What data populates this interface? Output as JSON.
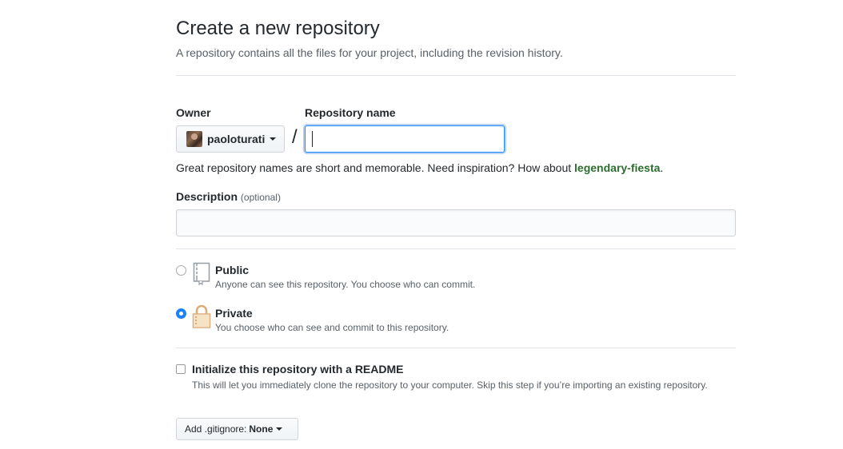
{
  "header": {
    "title": "Create a new repository",
    "subtitle": "A repository contains all the files for your project, including the revision history."
  },
  "owner": {
    "label": "Owner",
    "value": "paoloturati"
  },
  "separator": "/",
  "repo_name": {
    "label": "Repository name",
    "value": "",
    "placeholder": ""
  },
  "hint": {
    "text": "Great repository names are short and memorable. Need inspiration? How about ",
    "suggestion": "legendary-fiesta",
    "end": "."
  },
  "description": {
    "label": "Description",
    "optional": "(optional)",
    "value": "",
    "placeholder": ""
  },
  "visibility": {
    "selected": "private",
    "options": [
      {
        "id": "public",
        "title": "Public",
        "desc": "Anyone can see this repository. You choose who can commit.",
        "icon": "repo-book-icon"
      },
      {
        "id": "private",
        "title": "Private",
        "desc": "You choose who can see and commit to this repository.",
        "icon": "lock-icon"
      }
    ]
  },
  "readme": {
    "label": "Initialize this repository with a README",
    "desc": "This will let you immediately clone the repository to your computer. Skip this step if you’re importing an existing repository.",
    "checked": false
  },
  "gitignore": {
    "label": "Add .gitignore:",
    "value": "None"
  },
  "colors": {
    "accent_blue": "#2188ff",
    "radio_checked": "#1a82fb",
    "suggestion_green": "#2c6e2f",
    "lock_gold": "#dbab79"
  }
}
